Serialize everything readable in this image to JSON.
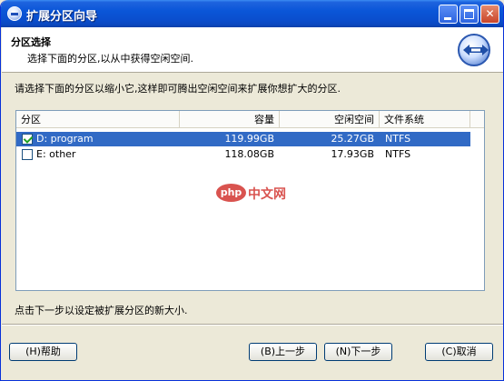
{
  "window": {
    "title": "扩展分区向导",
    "icon": "wizard-app-icon",
    "controls": {
      "minimize": "minimize-icon",
      "maximize": "maximize-icon",
      "close": "close-icon"
    }
  },
  "header": {
    "title": "分区选择",
    "subtitle": "选择下面的分区,以从中获得空闲空间.",
    "logo": "partition-logo-icon"
  },
  "instruction": "请选择下面的分区以缩小它,这样即可腾出空闲空间来扩展你想扩大的分区.",
  "table": {
    "columns": [
      "分区",
      "容量",
      "空闲空间",
      "文件系统"
    ],
    "rows": [
      {
        "checked": true,
        "name": "D: program",
        "capacity": "119.99GB",
        "free": "25.27GB",
        "fs": "NTFS",
        "selected": true
      },
      {
        "checked": false,
        "name": "E: other",
        "capacity": "118.08GB",
        "free": "17.93GB",
        "fs": "NTFS",
        "selected": false
      }
    ]
  },
  "watermark": {
    "logo": "php",
    "text": "中文网"
  },
  "footer": "点击下一步以设定被扩展分区的新大小.",
  "buttons": {
    "help": "(H)帮助",
    "prev": "(B)上一步",
    "next": "(N)下一步",
    "cancel": "(C)取消"
  },
  "colors": {
    "titlebar": "#0a56d8",
    "selection": "#316ac5",
    "dialog_bg": "#ece9d8",
    "watermark": "#d9534f"
  }
}
